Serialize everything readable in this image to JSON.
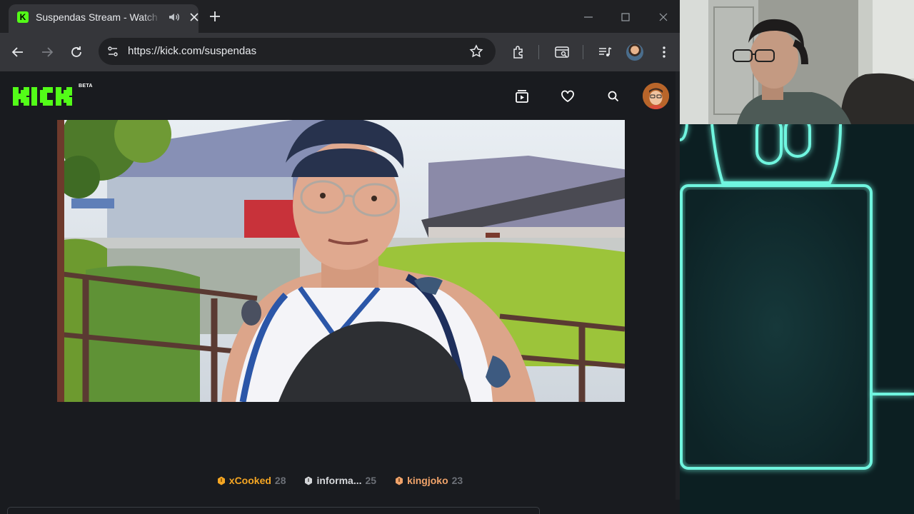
{
  "browser": {
    "tab": {
      "favicon_letter": "K",
      "title": "Suspendas Stream - Watch Live on Kick",
      "audio_icon": "speaker-icon",
      "close_icon": "close-icon"
    },
    "new_tab_icon": "plus-icon",
    "window_controls": [
      "minimize-icon",
      "maximize-icon",
      "close-icon"
    ],
    "toolbar": {
      "icons": [
        "back-arrow-icon",
        "forward-arrow-icon",
        "reload-icon",
        "site-settings-icon",
        "bookmark-star-icon",
        "extensions-icon",
        "tab-search-icon",
        "media-control-icon",
        "profile-avatar",
        "more-menu-icon"
      ],
      "url": "https://kick.com/suspendas"
    }
  },
  "kick": {
    "brand": "KICK",
    "beta_label": "BETA",
    "brand_color": "#53fc18",
    "nav_icons": [
      "browse-icon",
      "following-heart-icon",
      "search-icon",
      "user-avatar"
    ],
    "stream": {
      "channel": "suspendas"
    },
    "leaderboard": [
      {
        "rank": "gold",
        "name": "xCooked",
        "score": "28"
      },
      {
        "rank": "silver",
        "name": "informa...",
        "score": "25"
      },
      {
        "rank": "bronze",
        "name": "kingjoko",
        "score": "23"
      }
    ]
  },
  "colors": {
    "gold": "#f5a623",
    "silver": "#d5d7da",
    "bronze": "#f0a36a",
    "neon": "#6ff5df"
  }
}
